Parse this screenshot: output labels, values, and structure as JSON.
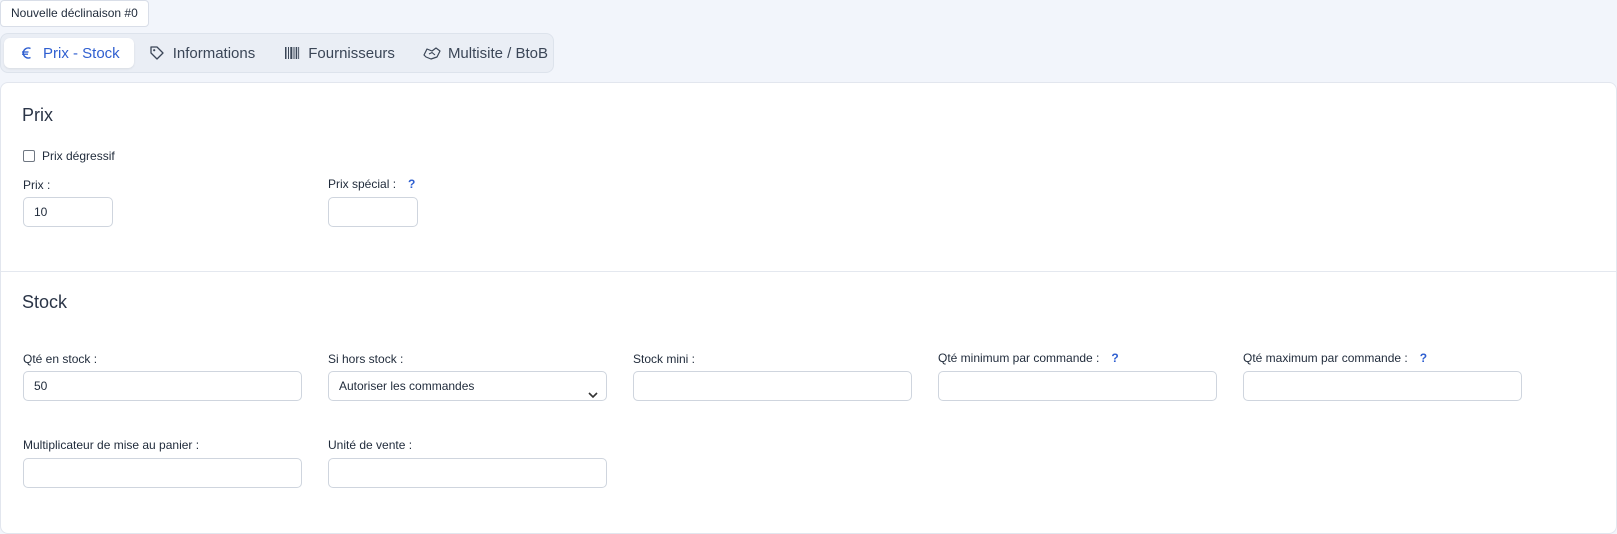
{
  "variant_badge": "Nouvelle déclinaison #0",
  "tabs": [
    {
      "label": "Prix - Stock",
      "icon": "euro-icon",
      "active": true
    },
    {
      "label": "Informations",
      "icon": "tag-icon",
      "active": false
    },
    {
      "label": "Fournisseurs",
      "icon": "barcode-icon",
      "active": false
    },
    {
      "label": "Multisite / BtoB",
      "icon": "handshake-icon",
      "active": false
    }
  ],
  "prix": {
    "title": "Prix",
    "degressive_label": "Prix dégressif",
    "degressive_checked": false,
    "price_label": "Prix :",
    "price_value": "10",
    "special_label": "Prix spécial :",
    "special_value": "",
    "help_glyph": "?"
  },
  "stock": {
    "title": "Stock",
    "qty_label": "Qté en stock :",
    "qty_value": "50",
    "out_label": "Si hors stock :",
    "out_value": "Autoriser les commandes",
    "min_label": "Stock mini :",
    "min_value": "",
    "min_order_label": "Qté minimum par commande :",
    "min_order_value": "",
    "max_order_label": "Qté maximum par commande :",
    "max_order_value": "",
    "multiplier_label": "Multiplicateur de mise au panier :",
    "multiplier_value": "",
    "unit_label": "Unité de vente :",
    "unit_value": "",
    "help_glyph": "?"
  },
  "colors": {
    "accent": "#2f5fd0",
    "background": "#f2f5fb",
    "panel": "#ffffff"
  }
}
